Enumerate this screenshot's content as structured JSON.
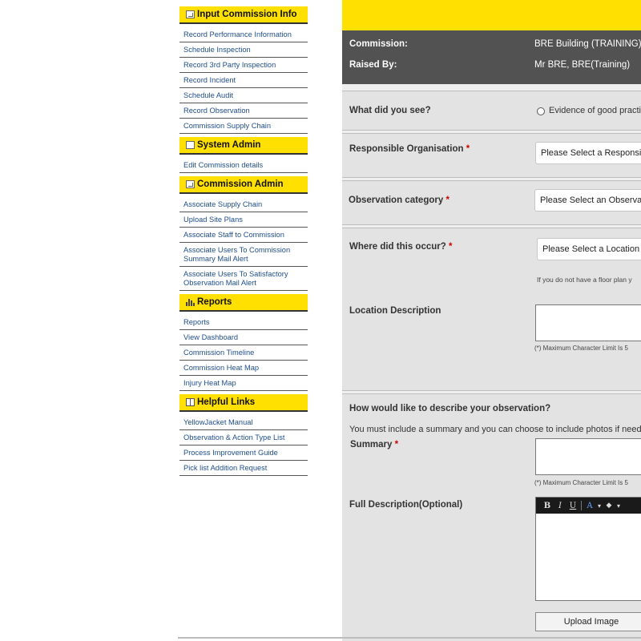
{
  "sidebar": {
    "sections": [
      {
        "title": "Input Commission Info",
        "items": [
          "Record Performance Information",
          "Schedule Inspection",
          "Record 3rd Party Inspection",
          "Record Incident",
          "Schedule Audit",
          "Record Observation",
          "Commission Supply Chain"
        ]
      },
      {
        "title": "System Admin",
        "items": [
          "Edit Commission details"
        ]
      },
      {
        "title": "Commission Admin",
        "items": [
          "Associate Supply Chain",
          "Upload Site Plans",
          "Associate Staff to Commission",
          "Associate Users To Commission Summary Mail Alert",
          "Associate Users To Satisfactory Observation Mail Alert"
        ]
      },
      {
        "title": "Reports",
        "items": [
          "Reports",
          "View Dashboard",
          "Commission Timeline",
          "Commission Heat Map",
          "Injury Heat Map"
        ]
      },
      {
        "title": "Helpful Links",
        "items": [
          "YellowJacket Manual",
          "Observation & Action Type List",
          "Process Improvement Guide",
          "Pick list Addition Request"
        ]
      }
    ]
  },
  "header": {
    "commission_label": "Commission:",
    "commission_value": "BRE Building (TRAINING)",
    "raised_by_label": "Raised By:",
    "raised_by_value": "Mr BRE, BRE(Training)"
  },
  "form": {
    "what_did_you_see_label": "What did you see?",
    "what_did_you_see_option": "Evidence of good practi",
    "responsible_org_label": "Responsible Organisation",
    "responsible_org_placeholder": "Please Select a Responsi",
    "observation_category_label": "Observation category",
    "observation_category_placeholder": "Please Select an Observa",
    "where_label": "Where did this occur?",
    "where_placeholder": "Please Select a Location",
    "floor_plan_hint": "If you do not have a floor plan y",
    "location_description_label": "Location Description",
    "char_limit_hint": "(*) Maximum Character Limit Is 5",
    "describe_heading": "How would like to describe your observation?",
    "describe_subtext": "You must include a summary and you can choose to include photos if need",
    "summary_label": "Summary",
    "summary_char_limit_hint": "(*) Maximum Character Limit Is 5",
    "full_description_label": "Full Description(Optional)",
    "required_mark": "*",
    "upload_button": "Upload Image"
  },
  "editor_toolbar": {
    "bold": "B",
    "italic": "I",
    "underline": "U",
    "font_color": "A",
    "dropdown_arrow": "▾",
    "highlight": "◆"
  },
  "colors": {
    "accent_yellow": "#ffe000",
    "header_dark": "#525252",
    "link_blue": "#1f4e8c",
    "required_red": "#d00000"
  },
  "icons": {
    "input_commission_info": "grid-icon",
    "system_admin": "checkbox-icon",
    "commission_admin": "grid-icon",
    "reports": "bar-chart-icon",
    "helpful_links": "book-icon"
  }
}
